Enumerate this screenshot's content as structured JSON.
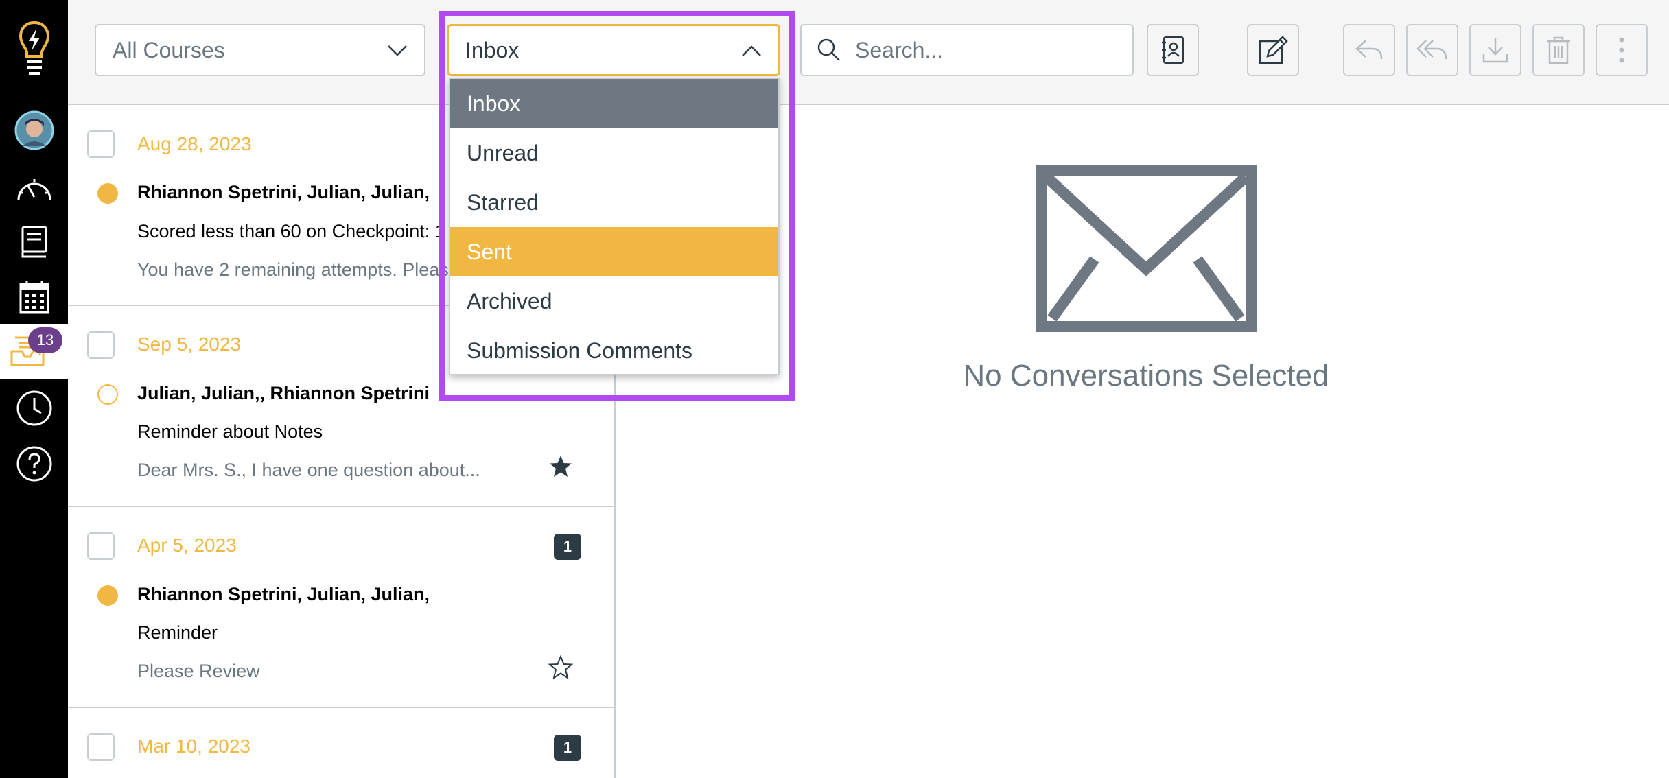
{
  "nav": {
    "badge_count": "13",
    "items": [
      {
        "icon": "logo-lightbulb-icon"
      },
      {
        "icon": "account-avatar"
      },
      {
        "icon": "dashboard-icon"
      },
      {
        "icon": "courses-icon"
      },
      {
        "icon": "calendar-icon"
      },
      {
        "icon": "inbox-icon",
        "active": true
      },
      {
        "icon": "history-clock-icon"
      },
      {
        "icon": "help-icon"
      }
    ]
  },
  "header": {
    "course_filter": "All Courses",
    "mailbox_filter": "Inbox",
    "search_placeholder": "Search..."
  },
  "dropdown": {
    "options": [
      "Inbox",
      "Unread",
      "Starred",
      "Sent",
      "Archived",
      "Submission Comments"
    ],
    "hovered": "Inbox",
    "selected": "Sent"
  },
  "conversations": [
    {
      "date": "Aug 28, 2023",
      "from": "Rhiannon Spetrini, Julian, Julian,",
      "subject": "Scored less than 60 on Checkpoint: 1",
      "preview": "You have 2 remaining attempts. Please",
      "unread": true
    },
    {
      "date": "Sep 5, 2023",
      "from": "Julian, Julian,, Rhiannon Spetrini",
      "subject": "Reminder about Notes",
      "preview": "Dear Mrs. S., I have one question about...",
      "unread": false,
      "starred": true
    },
    {
      "date": "Apr 5, 2023",
      "from": "Rhiannon Spetrini, Julian, Julian,",
      "subject": "Reminder",
      "preview": "Please Review",
      "unread": true,
      "count": "1",
      "starred": false
    },
    {
      "date": "Mar 10, 2023",
      "count": "1"
    }
  ],
  "detail": {
    "empty_title": "No Conversations Selected"
  },
  "colors": {
    "accent": "#f0b843",
    "highlight": "#b14af0",
    "nav_bg": "#000000",
    "badge": "#6b3f8c"
  }
}
